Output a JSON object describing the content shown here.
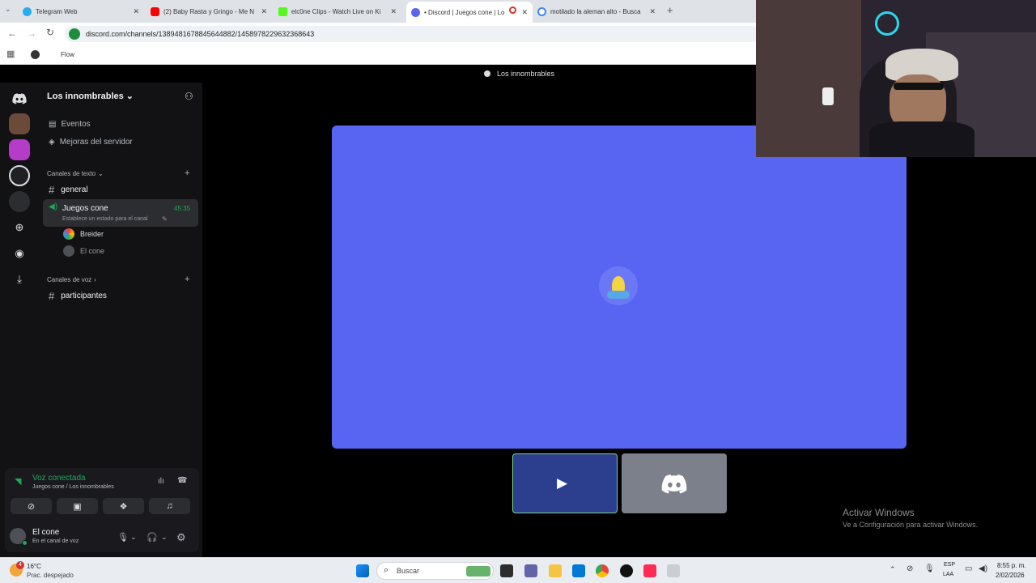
{
  "browser": {
    "tabs": [
      {
        "label": "Telegram Web",
        "color": "#2aabee"
      },
      {
        "label": "(2) Baby Rasta y Gringo - Me N",
        "color": "#ff0000"
      },
      {
        "label": "elc0ne Clips - Watch Live on Ki",
        "color": "#53fc18"
      },
      {
        "label": "• Discord | Juegos cone | Lo",
        "color": "#5865f2"
      },
      {
        "label": "motilado la aleman alto - Busca",
        "color": "#4285f4"
      }
    ],
    "url": "discord.com/channels/1389481678845644882/1458978229632368643",
    "bookmark": "Flow",
    "new_tab": "+"
  },
  "discord": {
    "top_title": "Los innombrables",
    "server_name": "Los innombrables",
    "events": "Eventos",
    "boosts": "Mejoras del servidor",
    "text_channels_header": "Canales de texto",
    "voice_channels_header": "Canales de voz",
    "channels": {
      "general": "general",
      "voice": "Juegos cone",
      "voice_timer": "45:35",
      "voice_status": "Establece un estado para el canal",
      "participants": "participantes"
    },
    "members": [
      {
        "name": "Breider"
      },
      {
        "name": "El cone"
      }
    ],
    "voice_panel": {
      "status": "Voz conectada",
      "location": "Juegos cone / Los innombrables"
    },
    "user": {
      "name": "El cone",
      "status": "En el canal de voz"
    }
  },
  "watermark": {
    "title": "Activar Windows",
    "subtitle": "Ve a Configuración para activar Windows."
  },
  "taskbar": {
    "weather_temp": "16°C",
    "weather_desc": "Prac. despejado",
    "weather_badge": "4",
    "search": "Buscar",
    "lang1": "ESP",
    "lang2": "LAA",
    "time": "8:55 p. m.",
    "date": "2/02/2026"
  },
  "colors": {
    "blurple": "#5865f2",
    "green": "#23a55a"
  }
}
